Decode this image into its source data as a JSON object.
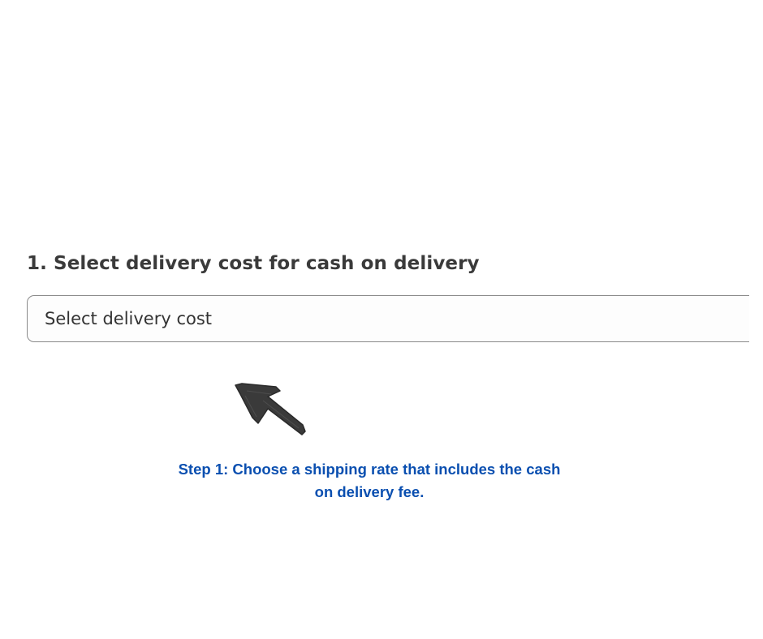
{
  "section": {
    "title": "1. Select delivery cost for cash on delivery"
  },
  "delivery_select": {
    "selected_value": "Select delivery cost"
  },
  "annotation": {
    "icon": "arrow-up-left-icon",
    "line1": "Step 1: Choose a shipping rate that includes the cash",
    "line2": "on delivery fee."
  },
  "colors": {
    "instruction_text": "#0a4fb0",
    "title_text": "#3a3a3a",
    "select_border": "#8a8a8a",
    "arrow": "#3a3a3a"
  }
}
